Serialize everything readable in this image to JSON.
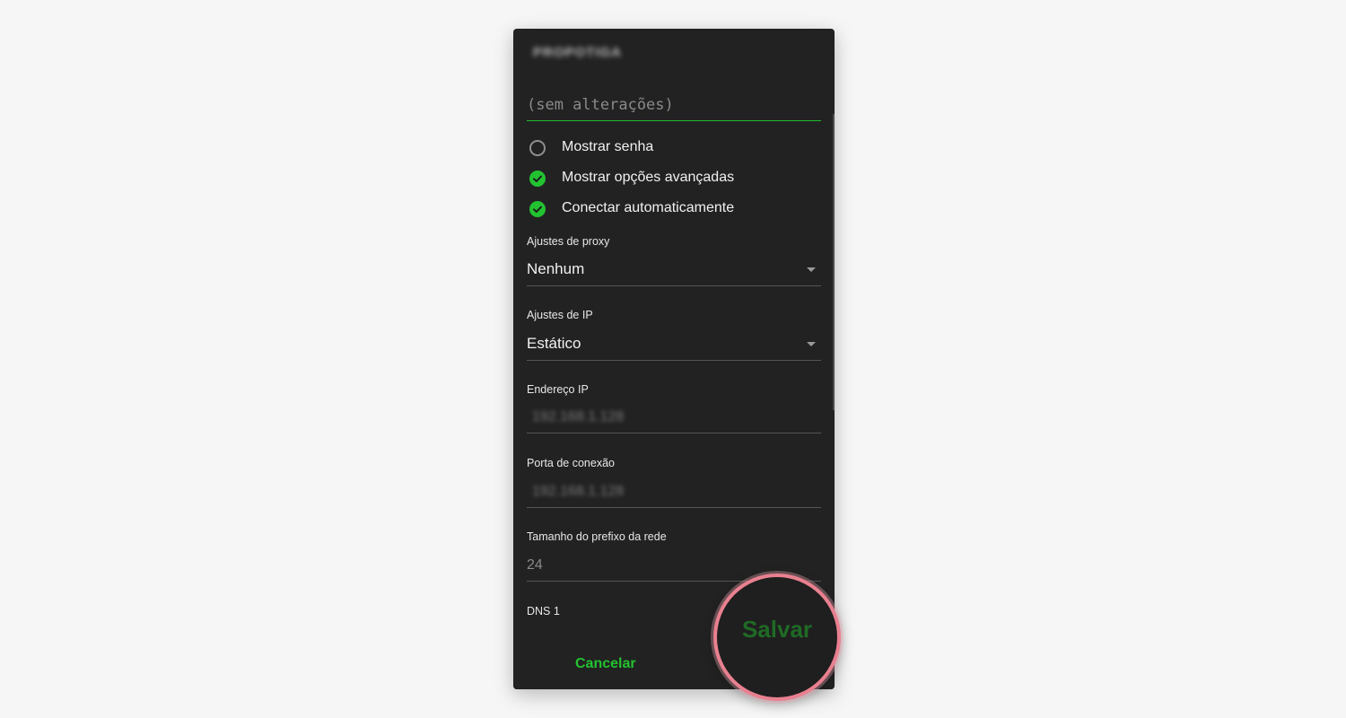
{
  "dialog": {
    "title": "PROPOTIGA",
    "password_placeholder": "(sem alterações)",
    "checkboxes": [
      {
        "label": "Mostrar senha",
        "checked": false
      },
      {
        "label": "Mostrar opções avançadas",
        "checked": true
      },
      {
        "label": "Conectar automaticamente",
        "checked": true
      }
    ],
    "proxy": {
      "label": "Ajustes de proxy",
      "value": "Nenhum"
    },
    "ip_settings": {
      "label": "Ajustes de IP",
      "value": "Estático"
    },
    "ip_address": {
      "label": "Endereço IP",
      "value": "192.168.1.128"
    },
    "gateway": {
      "label": "Porta de conexão",
      "value": "192.168.1.128"
    },
    "prefix": {
      "label": "Tamanho do prefixo da rede",
      "value": "24"
    },
    "dns1": {
      "label": "DNS 1"
    },
    "buttons": {
      "cancel": "Cancelar",
      "save": "Salvar"
    }
  },
  "colors": {
    "accent": "#22c231",
    "highlight_ring": "#e8808f",
    "dialog_bg": "#222222"
  }
}
